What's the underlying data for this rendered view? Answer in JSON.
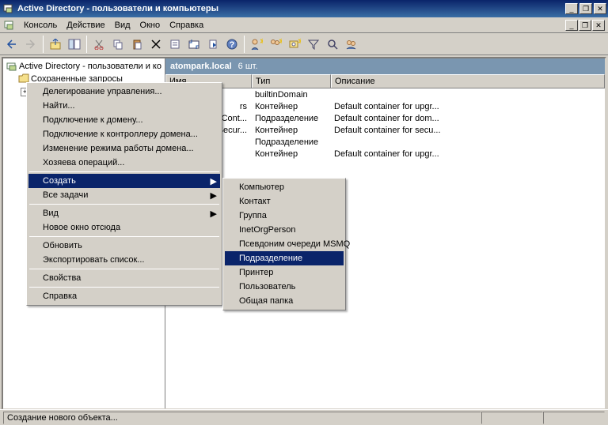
{
  "window": {
    "title": "Active Directory - пользователи и компьютеры"
  },
  "menu": {
    "console": "Консоль",
    "action": "Действие",
    "view": "Вид",
    "window": "Окно",
    "help": "Справка"
  },
  "tree": {
    "root": "Active Directory - пользователи и ко",
    "saved": "Сохраненные запросы"
  },
  "path": {
    "domain": "atompark.local",
    "count": "6 шт."
  },
  "cols": {
    "name": "Имя",
    "type": "Тип",
    "desc": "Описание"
  },
  "rows": [
    {
      "name": "",
      "type": "builtinDomain",
      "desc": ""
    },
    {
      "name": "rs",
      "type": "Контейнер",
      "desc": "Default container for upgr..."
    },
    {
      "name": "Cont...",
      "type": "Подразделение",
      "desc": "Default container for dom..."
    },
    {
      "name": "Secur...",
      "type": "Контейнер",
      "desc": "Default container for secu..."
    },
    {
      "name": "",
      "type": "Подразделение",
      "desc": ""
    },
    {
      "name": "",
      "type": "Контейнер",
      "desc": "Default container for upgr..."
    }
  ],
  "ctx": {
    "delegate": "Делегирование управления...",
    "find": "Найти...",
    "connect_domain": "Подключение к домену...",
    "connect_dc": "Подключение к контроллеру домена...",
    "raise": "Изменение режима работы домена...",
    "masters": "Хозяева операций...",
    "create": "Создать",
    "alltasks": "Все задачи",
    "view": "Вид",
    "newwin": "Новое окно отсюда",
    "refresh": "Обновить",
    "export": "Экспортировать список...",
    "props": "Свойства",
    "help": "Справка"
  },
  "sub": {
    "computer": "Компьютер",
    "contact": "Контакт",
    "group": "Группа",
    "inetorg": "InetOrgPerson",
    "msmq": "Псевдоним очереди MSMQ",
    "ou": "Подразделение",
    "printer": "Принтер",
    "user": "Пользователь",
    "shared": "Общая папка"
  },
  "status": "Создание нового объекта..."
}
